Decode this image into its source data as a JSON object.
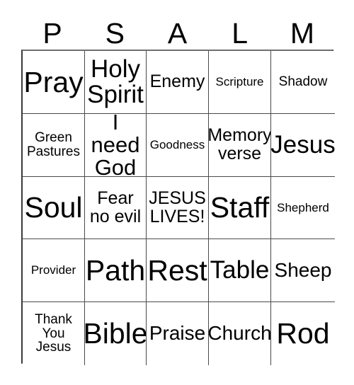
{
  "card": {
    "title_letters": [
      "P",
      "S",
      "A",
      "L",
      "M"
    ],
    "grid": {
      "rows": [
        [
          {
            "text": "Pray",
            "size": "fs-xxl"
          },
          {
            "text": "Holy\nSpirit",
            "size": "fs-xl"
          },
          {
            "text": "Enemy",
            "size": "fs-m"
          },
          {
            "text": "Scripture",
            "size": "fs-xs"
          },
          {
            "text": "Shadow",
            "size": "fs-s"
          }
        ],
        [
          {
            "text": "Green\nPastures",
            "size": "fs-s"
          },
          {
            "text": "I need\nGod",
            "size": "fs-l"
          },
          {
            "text": "Goodness",
            "size": "fs-xs"
          },
          {
            "text": "Memory\nverse",
            "size": "fs-m"
          },
          {
            "text": "Jesus",
            "size": "fs-xl"
          }
        ],
        [
          {
            "text": "Soul",
            "size": "fs-xxl"
          },
          {
            "text": "Fear\nno evil",
            "size": "fs-m"
          },
          {
            "text": "JESUS\nLIVES!",
            "size": "fs-m"
          },
          {
            "text": "Staff",
            "size": "fs-xxl"
          },
          {
            "text": "Shepherd",
            "size": "fs-xs"
          }
        ],
        [
          {
            "text": "Provider",
            "size": "fs-xs"
          },
          {
            "text": "Path",
            "size": "fs-xxl"
          },
          {
            "text": "Rest",
            "size": "fs-xxl"
          },
          {
            "text": "Table",
            "size": "fs-xl"
          },
          {
            "text": "Sheep",
            "size": "fs-ml"
          }
        ],
        [
          {
            "text": "Thank\nYou\nJesus",
            "size": "fs-s"
          },
          {
            "text": "Bible",
            "size": "fs-xxl"
          },
          {
            "text": "Praise",
            "size": "fs-ml"
          },
          {
            "text": "Church",
            "size": "fs-ml"
          },
          {
            "text": "Rod",
            "size": "fs-xxl"
          }
        ]
      ]
    },
    "colors": {
      "background": "#ffffff",
      "text": "#000000",
      "grid_line": "#4a4a4a",
      "grid_outer": "#6f6f6f"
    }
  }
}
